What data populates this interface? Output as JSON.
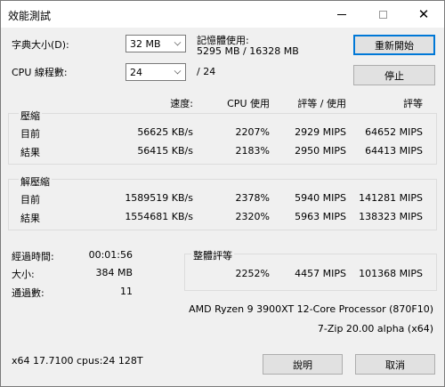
{
  "window": {
    "title": "效能測試",
    "controls": {
      "minimize": "minimize",
      "maximize": "maximize",
      "close": "✕"
    }
  },
  "settings": {
    "dict_label": "字典大小(D):",
    "dict_value": "32 MB",
    "threads_label": "CPU 線程數:",
    "threads_value": "24",
    "threads_total": "/ 24",
    "memory_label": "記憶體使用:",
    "memory_value": "5295 MB / 16328 MB"
  },
  "buttons": {
    "restart": "重新開始",
    "stop": "停止",
    "help": "說明",
    "cancel": "取消"
  },
  "table": {
    "headers": [
      "速度:",
      "CPU 使用",
      "評等 / 使用",
      "評等"
    ],
    "compress": {
      "label": "壓縮",
      "rows": [
        {
          "name": "目前",
          "speed": "56625 KB/s",
          "cpu": "2207%",
          "rating_usage": "2929 MIPS",
          "rating": "64652 MIPS"
        },
        {
          "name": "結果",
          "speed": "56415 KB/s",
          "cpu": "2183%",
          "rating_usage": "2950 MIPS",
          "rating": "64413 MIPS"
        }
      ]
    },
    "decompress": {
      "label": "解壓縮",
      "rows": [
        {
          "name": "目前",
          "speed": "1589519 KB/s",
          "cpu": "2378%",
          "rating_usage": "5940 MIPS",
          "rating": "141281 MIPS"
        },
        {
          "name": "結果",
          "speed": "1554681 KB/s",
          "cpu": "2320%",
          "rating_usage": "5963 MIPS",
          "rating": "138323 MIPS"
        }
      ]
    }
  },
  "stats": {
    "elapsed_label": "經過時間:",
    "elapsed_value": "00:01:56",
    "size_label": "大小:",
    "size_value": "384 MB",
    "passes_label": "通過數:",
    "passes_value": "11"
  },
  "overall": {
    "label": "整體評等",
    "cpu": "2252%",
    "rating_usage": "4457 MIPS",
    "rating": "101368 MIPS"
  },
  "system": {
    "cpu_name": "AMD Ryzen 9 3900XT 12-Core Processor (870F10)",
    "app_version": "7-Zip 20.00 alpha (x64)",
    "build_info": "x64 17.7100 cpus:24 128T"
  }
}
